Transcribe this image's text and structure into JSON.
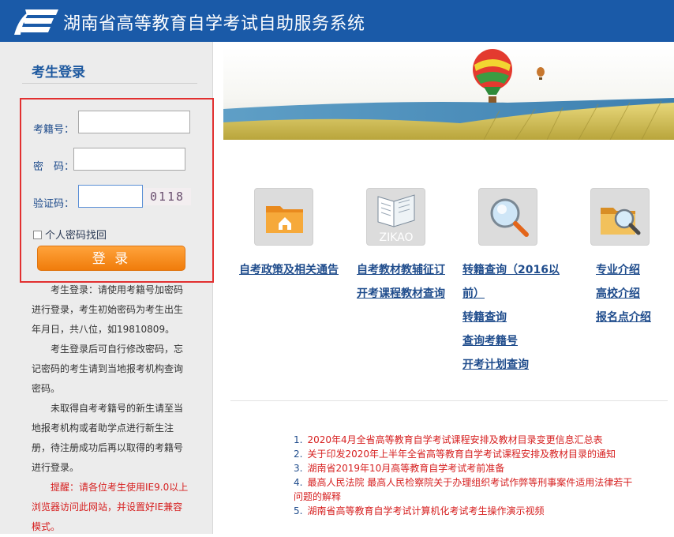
{
  "header": {
    "title": "湖南省高等教育自学考试自助服务系统",
    "background": "#1a5aa8"
  },
  "login": {
    "title": "考生登录",
    "exam_no_label": "考籍号：",
    "password_label": "密　码：",
    "captcha_label": "验证码：",
    "captcha_text": "0118",
    "recover_label": "个人密码找回",
    "submit_label": "登 录",
    "highlight_color": "#e23030",
    "button_color": "#f4891f"
  },
  "instructions": [
    "考生登录：请使用考籍号加密码进行登录，考生初始密码为考生出生年月日，共八位，如19810809。",
    "考生登录后可自行修改密码，忘记密码的考生请到当地报考机构查询密码。",
    "未取得自考考籍号的新生请至当地报考机构或者助学点进行新生注册，待注册成功后再以取得的考籍号进行登录。"
  ],
  "notice": "提醒：请各位考生使用IE9.0以上浏览器访问此网站，并设置好IE兼容模式。",
  "tiles": [
    {
      "icon": "folder-home-icon"
    },
    {
      "icon": "zikao-book-icon",
      "text": "ZIKAO"
    },
    {
      "icon": "magnifier-icon"
    },
    {
      "icon": "folder-search-icon"
    }
  ],
  "links": {
    "col1": [
      "自考政策及相关通告"
    ],
    "col2": [
      "自考教材教辅征订",
      "开考课程教材查询"
    ],
    "col3": [
      "转籍查询（2016以",
      "前）",
      "转籍查询",
      "查询考籍号",
      "开考计划查询"
    ],
    "col4": [
      "专业介绍",
      "高校介绍",
      "报名点介绍"
    ]
  },
  "news": [
    {
      "num": "1.",
      "text": "2020年4月全省高等教育自学考试课程安排及教材目录变更信息汇总表"
    },
    {
      "num": "2.",
      "text": "关于印发2020年上半年全省高等教育自学考试课程安排及教材目录的通知"
    },
    {
      "num": "3.",
      "text": "湖南省2019年10月高等教育自学考试考前准备"
    },
    {
      "num": "4.",
      "text": "最高人民法院 最高人民检察院关于办理组织考试作弊等刑事案件适用法律若干问题的解释"
    },
    {
      "num": "5.",
      "text": "湖南省高等教育自学考试计算机化考试考生操作演示视频"
    }
  ]
}
